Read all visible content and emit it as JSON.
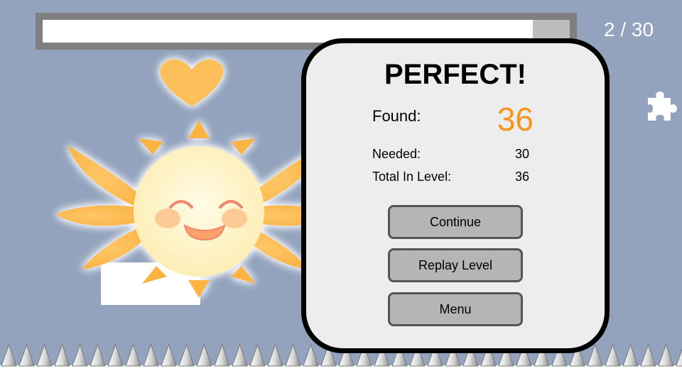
{
  "progress": {
    "fraction": 0.93
  },
  "counter": {
    "text": "2 / 30"
  },
  "results": {
    "title": "PERFECT!",
    "found_label": "Found:",
    "found_value": "36",
    "needed_label": "Needed:",
    "needed_value": "30",
    "total_label": "Total In Level:",
    "total_value": "36"
  },
  "buttons": {
    "continue": "Continue",
    "replay": "Replay Level",
    "menu": "Menu"
  },
  "icons": [
    "puzzle-piece-icon",
    "heart-icon",
    "sun-mascot"
  ],
  "colors": {
    "accent": "#f7941d",
    "background": "#93a3bd",
    "panel": "#ededee"
  }
}
